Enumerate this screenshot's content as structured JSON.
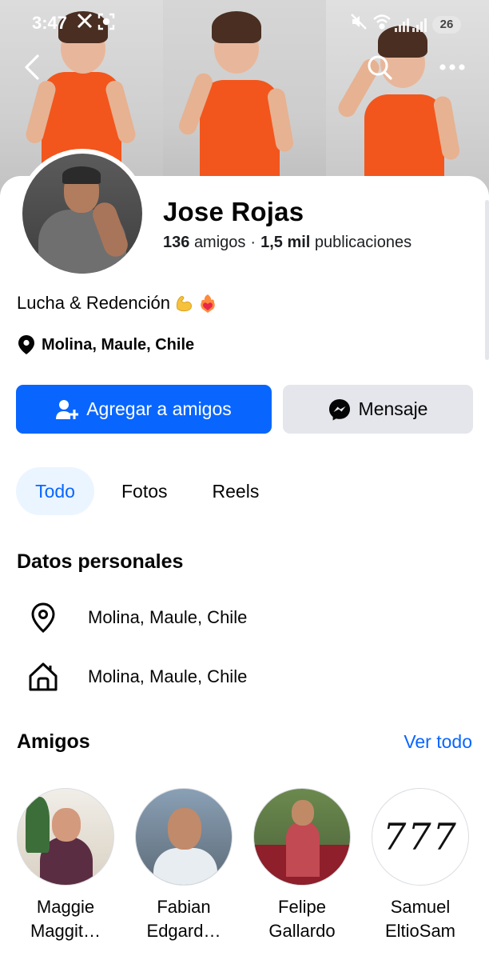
{
  "status_bar": {
    "time": "3:47",
    "battery": "26"
  },
  "profile": {
    "name": "Jose Rojas",
    "friends_count": "136",
    "friends_label": "amigos",
    "separator": "·",
    "posts_count": "1,5 mil",
    "posts_label": "publicaciones",
    "bio": "Lucha & Redención",
    "location": "Molina, Maule, Chile"
  },
  "actions": {
    "add_friend_label": "Agregar a amigos",
    "message_label": "Mensaje"
  },
  "tabs": [
    {
      "label": "Todo",
      "active": true
    },
    {
      "label": "Fotos",
      "active": false
    },
    {
      "label": "Reels",
      "active": false
    }
  ],
  "personal_details": {
    "title": "Datos personales",
    "items": [
      {
        "icon": "location-pin-icon",
        "text": "Molina, Maule, Chile"
      },
      {
        "icon": "home-icon",
        "text": "Molina, Maule, Chile"
      }
    ]
  },
  "friends_section": {
    "title": "Amigos",
    "see_all_label": "Ver todo",
    "items": [
      {
        "line1": "Maggie",
        "line2": "Maggit…"
      },
      {
        "line1": "Fabian",
        "line2": "Edgard…"
      },
      {
        "line1": "Felipe",
        "line2": "Gallardo"
      },
      {
        "line1": "Samuel",
        "line2": "EltioSam",
        "photo_text": "777"
      }
    ]
  },
  "colors": {
    "accent": "#0866ff",
    "active_tab_bg": "#ebf5ff",
    "secondary_button": "#e4e6eb",
    "cover_dress": "#f2561d"
  }
}
